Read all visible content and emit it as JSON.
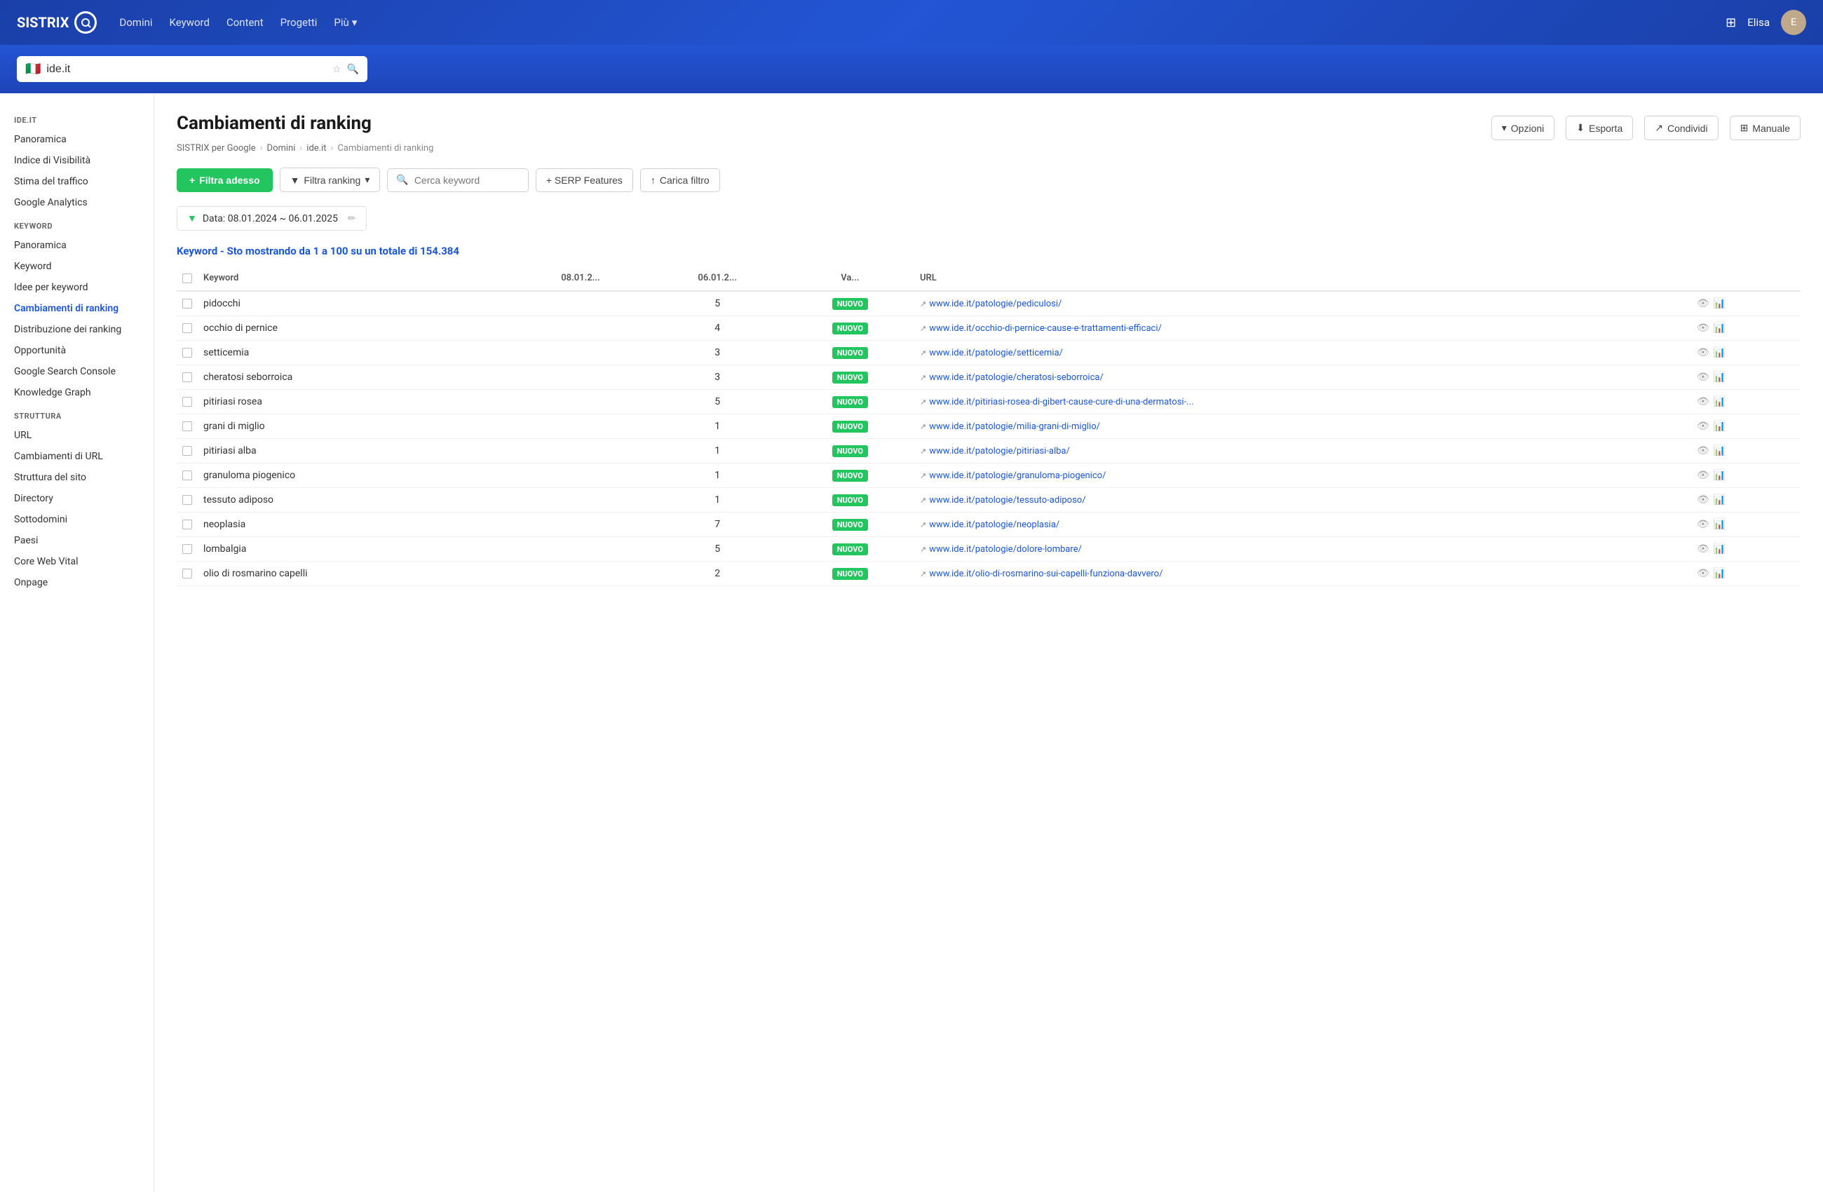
{
  "header": {
    "logo_text": "SISTRIX",
    "nav_items": [
      {
        "label": "Domini",
        "active": false
      },
      {
        "label": "Keyword",
        "active": false
      },
      {
        "label": "Content",
        "active": false
      },
      {
        "label": "Progetti",
        "active": false
      },
      {
        "label": "Più",
        "active": false,
        "has_arrow": true
      }
    ],
    "user_name": "Elisa"
  },
  "search_bar": {
    "flag": "🇮🇹",
    "value": "ide.it",
    "placeholder": "ide.it"
  },
  "sidebar": {
    "domain_section": {
      "title": "IDE.IT",
      "items": [
        {
          "label": "Panoramica",
          "active": false
        },
        {
          "label": "Indice di Visibilità",
          "active": false
        },
        {
          "label": "Stima del traffico",
          "active": false
        },
        {
          "label": "Google Analytics",
          "active": false
        }
      ]
    },
    "keyword_section": {
      "title": "KEYWORD",
      "items": [
        {
          "label": "Panoramica",
          "active": false
        },
        {
          "label": "Keyword",
          "active": false
        },
        {
          "label": "Idee per keyword",
          "active": false
        },
        {
          "label": "Cambiamenti di ranking",
          "active": true
        },
        {
          "label": "Distribuzione dei ranking",
          "active": false
        },
        {
          "label": "Opportunità",
          "active": false
        },
        {
          "label": "Google Search Console",
          "active": false
        },
        {
          "label": "Knowledge Graph",
          "active": false
        }
      ]
    },
    "struttura_section": {
      "title": "STRUTTURA",
      "items": [
        {
          "label": "URL",
          "active": false
        },
        {
          "label": "Cambiamenti di URL",
          "active": false
        },
        {
          "label": "Struttura del sito",
          "active": false
        },
        {
          "label": "Directory",
          "active": false
        },
        {
          "label": "Sottodomini",
          "active": false
        },
        {
          "label": "Paesi",
          "active": false
        },
        {
          "label": "Core Web Vital",
          "active": false
        },
        {
          "label": "Onpage",
          "active": false
        }
      ]
    }
  },
  "content": {
    "page_title": "Cambiamenti di ranking",
    "breadcrumb": {
      "items": [
        "SISTRIX per Google",
        "Domini",
        "ide.it",
        "Cambiamenti di ranking"
      ]
    },
    "toolbar": {
      "filter_button": "Filtra adesso",
      "filtra_ranking": "Filtra ranking",
      "search_placeholder": "Cerca keyword",
      "serp_features": "+ SERP Features",
      "carica_filtro": "Carica filtro",
      "opzioni": "Opzioni",
      "esporta": "Esporta",
      "condividi": "Condividi",
      "manuale": "Manuale"
    },
    "date_filter": {
      "label": "Data: 08.01.2024 ~ 06.01.2025"
    },
    "result_count": "Keyword - Sto mostrando da 1 a 100 su un totale di 154.384",
    "table": {
      "columns": [
        "",
        "Keyword",
        "08.01.2...",
        "06.01.2...",
        "Va...",
        "URL"
      ],
      "rows": [
        {
          "keyword": "pidocchi",
          "col1": "",
          "col2": "5",
          "badge": "NUOVO",
          "url": "www.ide.it/patologie/pediculosi/"
        },
        {
          "keyword": "occhio di pernice",
          "col1": "",
          "col2": "4",
          "badge": "NUOVO",
          "url": "www.ide.it/occhio-di-pernice-cause-e-trattamenti-efficaci/"
        },
        {
          "keyword": "setticemia",
          "col1": "",
          "col2": "3",
          "badge": "NUOVO",
          "url": "www.ide.it/patologie/setticemia/"
        },
        {
          "keyword": "cheratosi seborroica",
          "col1": "",
          "col2": "3",
          "badge": "NUOVO",
          "url": "www.ide.it/patologie/cheratosi-seborroica/"
        },
        {
          "keyword": "pitiriasi rosea",
          "col1": "",
          "col2": "5",
          "badge": "NUOVO",
          "url": "www.ide.it/pitiriasi-rosea-di-gibert-cause-cure-di-una-dermatosi-..."
        },
        {
          "keyword": "grani di miglio",
          "col1": "",
          "col2": "1",
          "badge": "NUOVO",
          "url": "www.ide.it/patologie/milia-grani-di-miglio/"
        },
        {
          "keyword": "pitiriasi alba",
          "col1": "",
          "col2": "1",
          "badge": "NUOVO",
          "url": "www.ide.it/patologie/pitiriasi-alba/"
        },
        {
          "keyword": "granuloma piogenico",
          "col1": "",
          "col2": "1",
          "badge": "NUOVO",
          "url": "www.ide.it/patologie/granuloma-piogenico/"
        },
        {
          "keyword": "tessuto adiposo",
          "col1": "",
          "col2": "1",
          "badge": "NUOVO",
          "url": "www.ide.it/patologie/tessuto-adiposo/"
        },
        {
          "keyword": "neoplasia",
          "col1": "",
          "col2": "7",
          "badge": "NUOVO",
          "url": "www.ide.it/patologie/neoplasia/"
        },
        {
          "keyword": "lombalgia",
          "col1": "",
          "col2": "5",
          "badge": "NUOVO",
          "url": "www.ide.it/patologie/dolore-lombare/"
        },
        {
          "keyword": "olio di rosmarino capelli",
          "col1": "",
          "col2": "2",
          "badge": "NUOVO",
          "url": "www.ide.it/olio-di-rosmarino-sui-capelli-funziona-davvero/"
        }
      ]
    }
  }
}
